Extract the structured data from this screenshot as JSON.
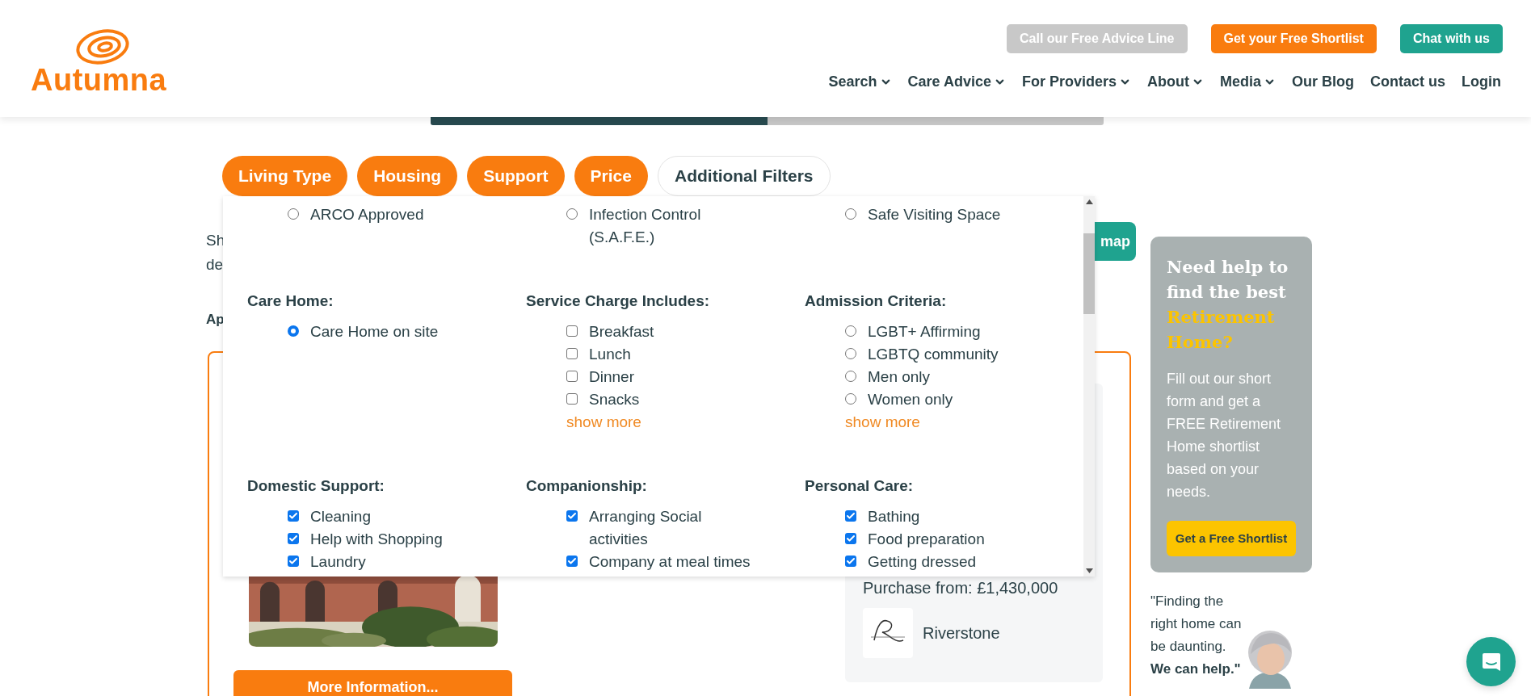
{
  "header": {
    "logo": "Autumna",
    "top_buttons": [
      {
        "label": "Call our Free Advice Line",
        "color": "#c8c8c8"
      },
      {
        "label": "Get your Free Shortlist",
        "color": "#f97c0f"
      },
      {
        "label": "Chat with us",
        "color": "#1fa38f"
      }
    ],
    "nav": [
      {
        "label": "Search",
        "dropdown": true
      },
      {
        "label": "Care Advice",
        "dropdown": true
      },
      {
        "label": "For Providers",
        "dropdown": true
      },
      {
        "label": "About",
        "dropdown": true
      },
      {
        "label": "Media",
        "dropdown": true
      },
      {
        "label": "Our Blog",
        "dropdown": false
      },
      {
        "label": "Contact us",
        "dropdown": false
      },
      {
        "label": "Login",
        "dropdown": false
      }
    ]
  },
  "progress": {
    "level": 0.5
  },
  "filter_tabs": [
    {
      "label": "Living Type",
      "selected": true
    },
    {
      "label": "Housing",
      "selected": true
    },
    {
      "label": "Support",
      "selected": true
    },
    {
      "label": "Price",
      "selected": true
    },
    {
      "label": "Additional Filters",
      "selected": false
    }
  ],
  "results": {
    "intro_lines": [
      "Sh",
      "de"
    ],
    "section_heading": "Ap",
    "map_button": "map",
    "listing": {
      "price": "Purchase from: £1,430,000",
      "provider": "Riverstone",
      "button": "More Information..."
    }
  },
  "filter_panel": {
    "rows": [
      {
        "columns": [
          {
            "kind": "radio",
            "options": [
              {
                "label": "ARCO Approved",
                "checked": false
              }
            ]
          },
          {
            "kind": "radio",
            "options": [
              {
                "label": "Infection Control (S.A.F.E.)",
                "checked": false
              }
            ]
          },
          {
            "kind": "radio",
            "options": [
              {
                "label": "Safe Visiting Space",
                "checked": false
              }
            ]
          }
        ]
      },
      {
        "columns": [
          {
            "heading": "Care Home:",
            "kind": "radio",
            "options": [
              {
                "label": "Care Home on site",
                "checked": true
              }
            ]
          },
          {
            "heading": "Service Charge Includes:",
            "kind": "checkbox",
            "options": [
              {
                "label": "Breakfast",
                "checked": false
              },
              {
                "label": "Lunch",
                "checked": false
              },
              {
                "label": "Dinner",
                "checked": false
              },
              {
                "label": "Snacks",
                "checked": false
              }
            ],
            "show_more": "show more"
          },
          {
            "heading": "Admission Criteria:",
            "kind": "radio",
            "options": [
              {
                "label": "LGBT+ Affirming",
                "checked": false
              },
              {
                "label": "LGBTQ community",
                "checked": false
              },
              {
                "label": "Men only",
                "checked": false
              },
              {
                "label": "Women only",
                "checked": false
              }
            ],
            "show_more": "show more"
          }
        ]
      },
      {
        "columns": [
          {
            "heading": "Domestic Support:",
            "kind": "checkbox",
            "options": [
              {
                "label": "Cleaning",
                "checked": true
              },
              {
                "label": "Help with Shopping",
                "checked": true
              },
              {
                "label": "Laundry",
                "checked": true
              }
            ]
          },
          {
            "heading": "Companionship:",
            "kind": "checkbox",
            "options": [
              {
                "label": "Arranging Social activities",
                "checked": true
              },
              {
                "label": "Company at meal times",
                "checked": true
              }
            ]
          },
          {
            "heading": "Personal Care:",
            "kind": "checkbox",
            "options": [
              {
                "label": "Bathing",
                "checked": true
              },
              {
                "label": "Food preparation",
                "checked": true
              },
              {
                "label": "Getting dressed",
                "checked": true
              }
            ]
          }
        ]
      }
    ]
  },
  "sidebar": {
    "heading": "Need help to find the best",
    "heading_highlight": "Retirement Home?",
    "body": "Fill out our short form and get a FREE Retirement Home shortlist based on your needs.",
    "button": "Get a Free Shortlist",
    "quote": "\"Finding the right home can be daunting. **We can help.\"**"
  }
}
